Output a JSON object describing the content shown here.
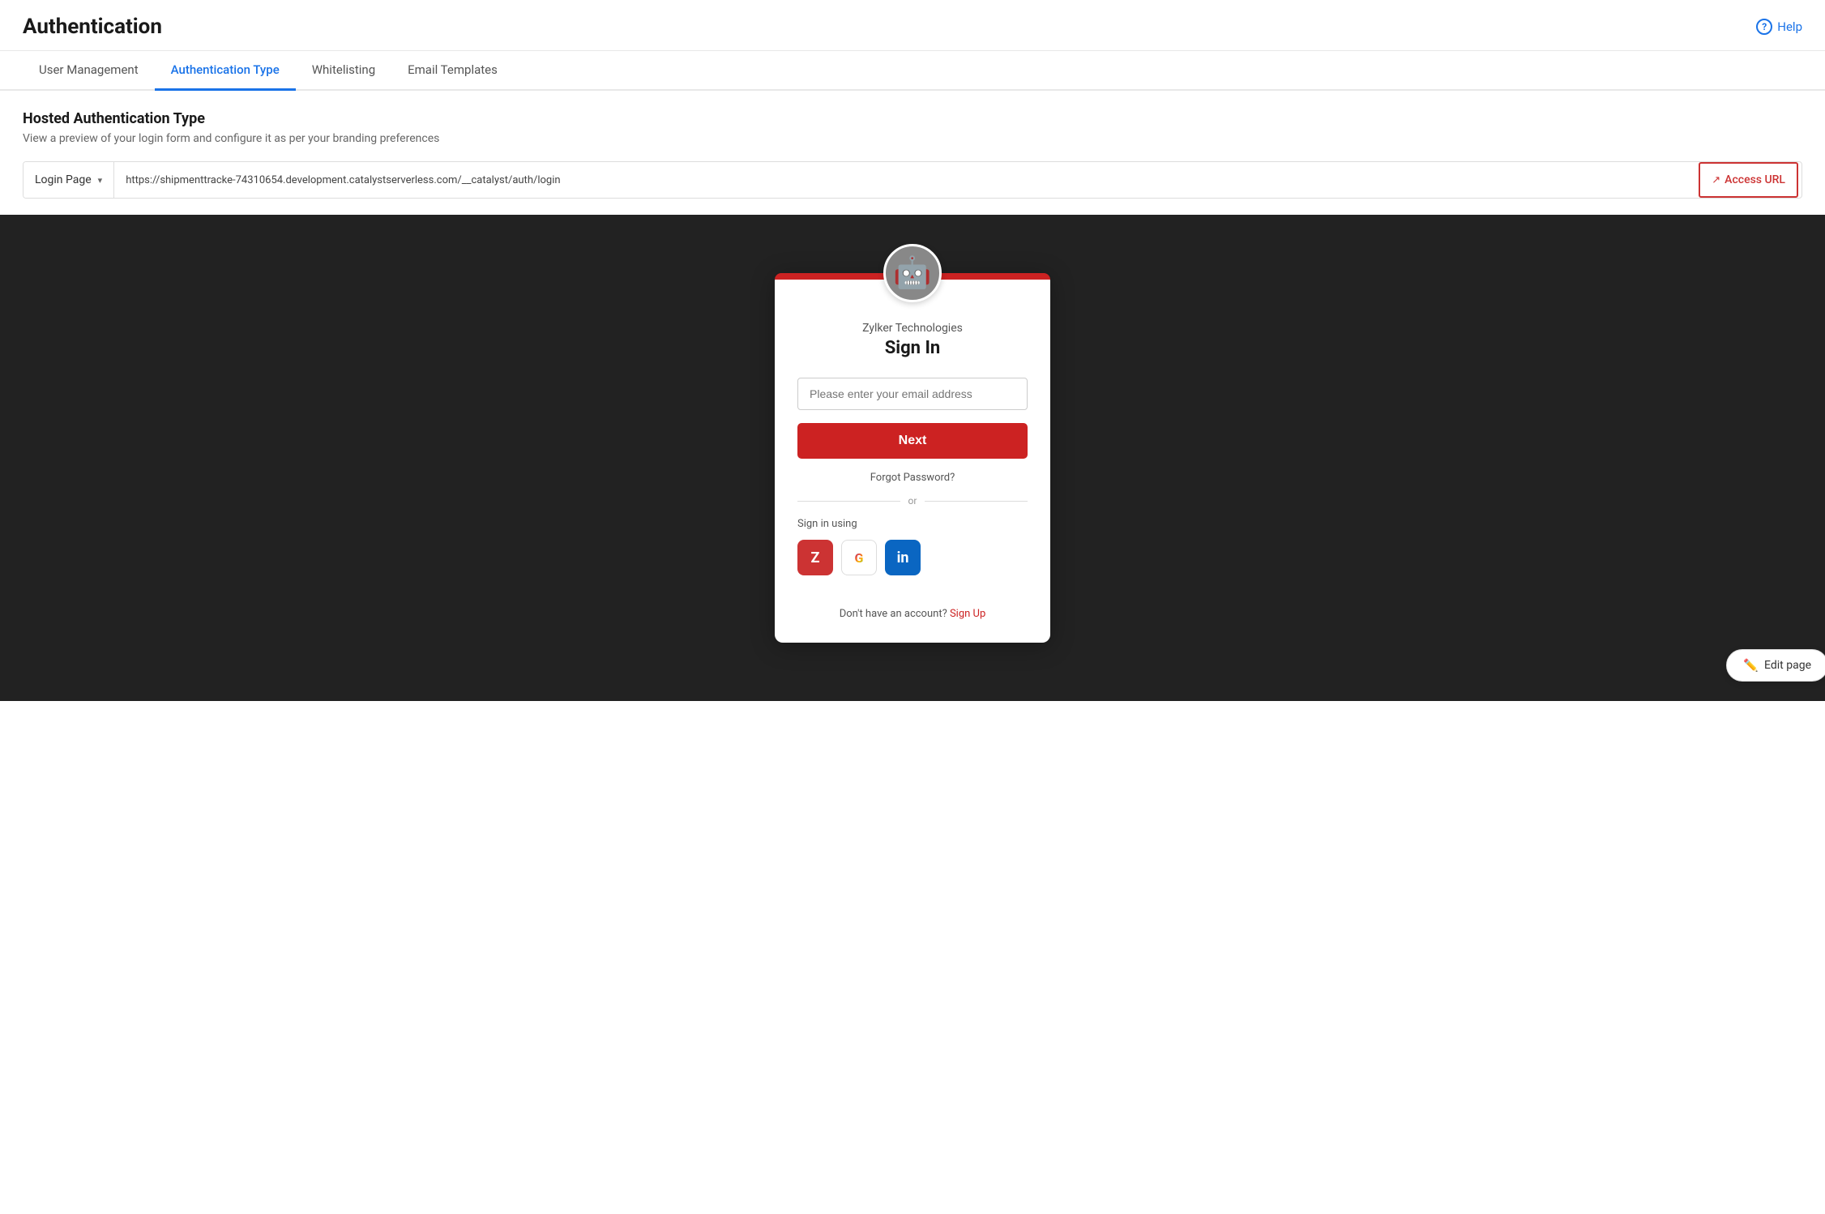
{
  "header": {
    "title": "Authentication",
    "help_label": "Help"
  },
  "tabs": [
    {
      "id": "user-management",
      "label": "User Management",
      "active": false
    },
    {
      "id": "authentication-type",
      "label": "Authentication Type",
      "active": true
    },
    {
      "id": "whitelisting",
      "label": "Whitelisting",
      "active": false
    },
    {
      "id": "email-templates",
      "label": "Email Templates",
      "active": false
    }
  ],
  "section": {
    "title": "Hosted Authentication Type",
    "description": "View a preview of your login form and configure it as per your branding preferences"
  },
  "url_bar": {
    "dropdown_label": "Login Page",
    "url_value": "https://shipmenttracke-74310654.development.catalystserverless.com/__catalyst/auth/login",
    "access_url_label": "Access URL"
  },
  "login_form": {
    "company_name": "Zylker Technologies",
    "sign_in_title": "Sign In",
    "email_placeholder": "Please enter your email address",
    "next_button": "Next",
    "forgot_password": "Forgot Password?",
    "or_text": "or",
    "sign_in_using": "Sign in using",
    "social_providers": [
      {
        "id": "zoho",
        "label": "Z"
      },
      {
        "id": "google",
        "label": "G"
      },
      {
        "id": "linkedin",
        "label": "in"
      }
    ],
    "signup_prompt": "Don't have an account?",
    "signup_link": "Sign Up"
  },
  "edit_page_btn": "Edit page"
}
